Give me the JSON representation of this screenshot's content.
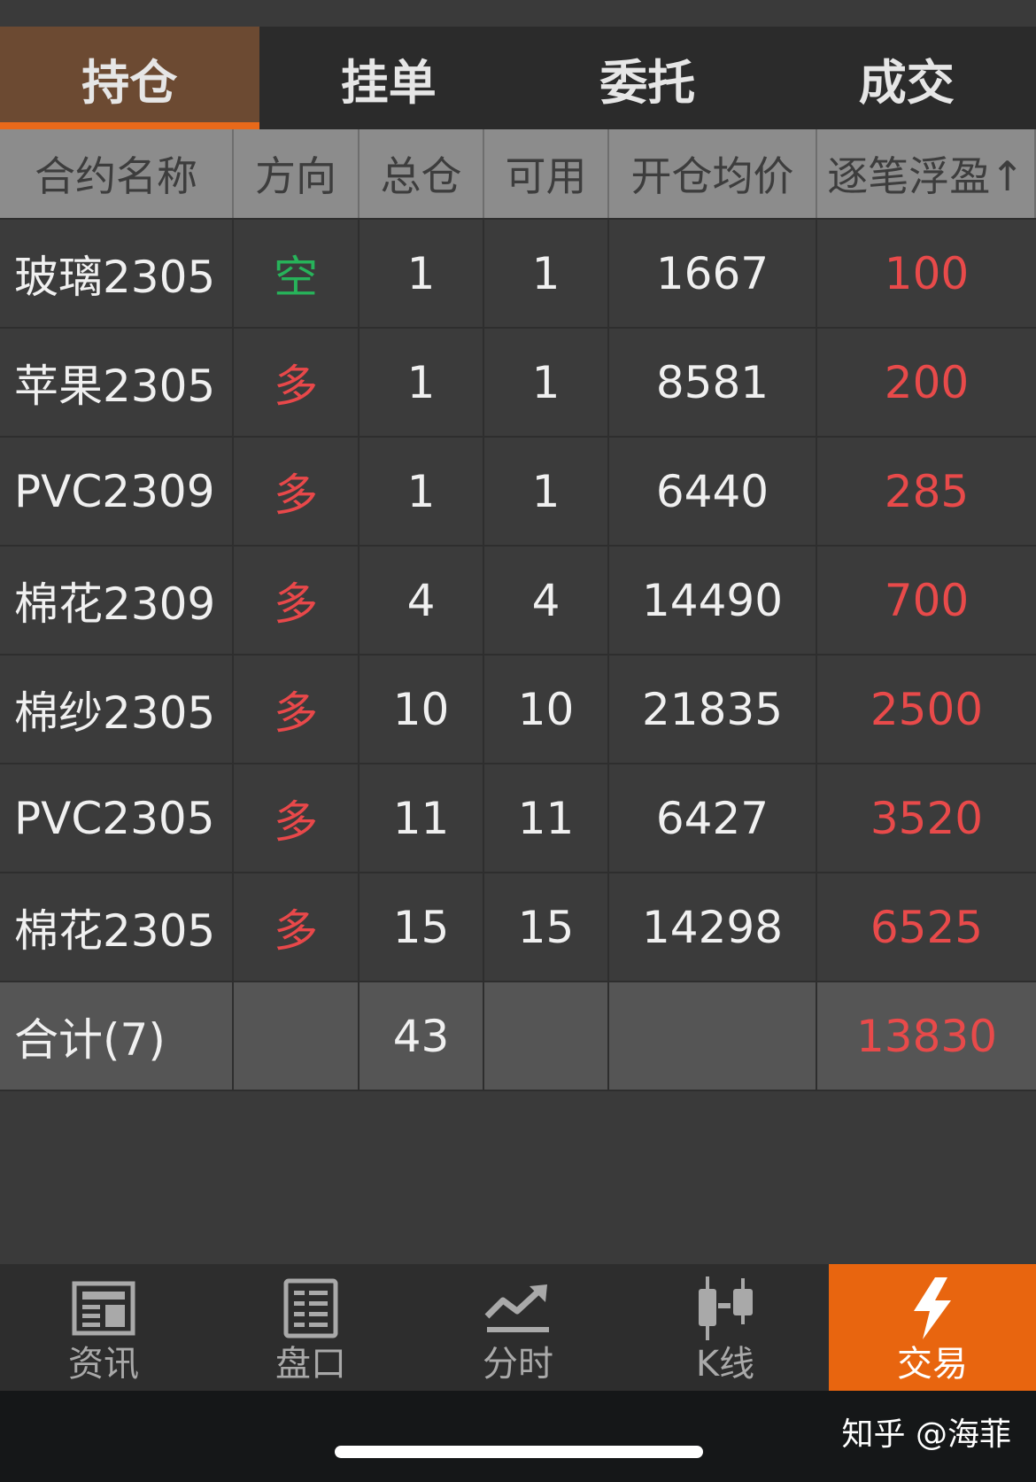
{
  "tabs": [
    {
      "label": "持仓",
      "active": true
    },
    {
      "label": "挂单",
      "active": false
    },
    {
      "label": "委托",
      "active": false
    },
    {
      "label": "成交",
      "active": false
    }
  ],
  "table": {
    "headers": [
      "合约名称",
      "方向",
      "总仓",
      "可用",
      "开仓均价",
      "逐笔浮盈↑"
    ],
    "rows": [
      {
        "name": "玻璃2305",
        "direction": "空",
        "total": "1",
        "available": "1",
        "avg_price": "1667",
        "pnl": "100"
      },
      {
        "name": "苹果2305",
        "direction": "多",
        "total": "1",
        "available": "1",
        "avg_price": "8581",
        "pnl": "200"
      },
      {
        "name": "PVC2309",
        "direction": "多",
        "total": "1",
        "available": "1",
        "avg_price": "6440",
        "pnl": "285"
      },
      {
        "name": "棉花2309",
        "direction": "多",
        "total": "4",
        "available": "4",
        "avg_price": "14490",
        "pnl": "700"
      },
      {
        "name": "棉纱2305",
        "direction": "多",
        "total": "10",
        "available": "10",
        "avg_price": "21835",
        "pnl": "2500"
      },
      {
        "name": "PVC2305",
        "direction": "多",
        "total": "11",
        "available": "11",
        "avg_price": "6427",
        "pnl": "3520"
      },
      {
        "name": "棉花2305",
        "direction": "多",
        "total": "15",
        "available": "15",
        "avg_price": "14298",
        "pnl": "6525"
      }
    ],
    "total": {
      "label": "合计(7)",
      "total": "43",
      "pnl": "13830"
    }
  },
  "bottom_nav": [
    {
      "label": "资讯",
      "icon": "news-icon",
      "active": false
    },
    {
      "label": "盘口",
      "icon": "order-book-icon",
      "active": false
    },
    {
      "label": "分时",
      "icon": "trend-chart-icon",
      "active": false
    },
    {
      "label": "K线",
      "icon": "candlestick-icon",
      "active": false
    },
    {
      "label": "交易",
      "icon": "lightning-icon",
      "active": true
    }
  ],
  "watermark": "知乎 @海菲",
  "colors": {
    "active_tab_bg": "#6c4a32",
    "accent_orange": "#e8691a",
    "short_green": "#27b35a",
    "long_red": "#e8484a",
    "profit_red": "#e84a4a"
  }
}
